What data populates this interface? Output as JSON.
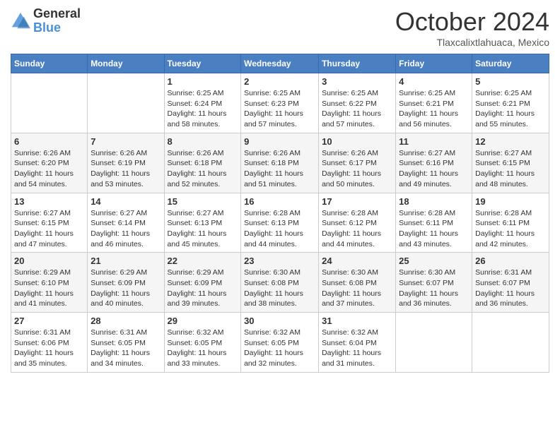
{
  "logo": {
    "general": "General",
    "blue": "Blue"
  },
  "header": {
    "month": "October 2024",
    "location": "Tlaxcalixtlahuaca, Mexico"
  },
  "days_of_week": [
    "Sunday",
    "Monday",
    "Tuesday",
    "Wednesday",
    "Thursday",
    "Friday",
    "Saturday"
  ],
  "weeks": [
    [
      {
        "day": "",
        "info": ""
      },
      {
        "day": "",
        "info": ""
      },
      {
        "day": "1",
        "info": "Sunrise: 6:25 AM\nSunset: 6:24 PM\nDaylight: 11 hours and 58 minutes."
      },
      {
        "day": "2",
        "info": "Sunrise: 6:25 AM\nSunset: 6:23 PM\nDaylight: 11 hours and 57 minutes."
      },
      {
        "day": "3",
        "info": "Sunrise: 6:25 AM\nSunset: 6:22 PM\nDaylight: 11 hours and 57 minutes."
      },
      {
        "day": "4",
        "info": "Sunrise: 6:25 AM\nSunset: 6:21 PM\nDaylight: 11 hours and 56 minutes."
      },
      {
        "day": "5",
        "info": "Sunrise: 6:25 AM\nSunset: 6:21 PM\nDaylight: 11 hours and 55 minutes."
      }
    ],
    [
      {
        "day": "6",
        "info": "Sunrise: 6:26 AM\nSunset: 6:20 PM\nDaylight: 11 hours and 54 minutes."
      },
      {
        "day": "7",
        "info": "Sunrise: 6:26 AM\nSunset: 6:19 PM\nDaylight: 11 hours and 53 minutes."
      },
      {
        "day": "8",
        "info": "Sunrise: 6:26 AM\nSunset: 6:18 PM\nDaylight: 11 hours and 52 minutes."
      },
      {
        "day": "9",
        "info": "Sunrise: 6:26 AM\nSunset: 6:18 PM\nDaylight: 11 hours and 51 minutes."
      },
      {
        "day": "10",
        "info": "Sunrise: 6:26 AM\nSunset: 6:17 PM\nDaylight: 11 hours and 50 minutes."
      },
      {
        "day": "11",
        "info": "Sunrise: 6:27 AM\nSunset: 6:16 PM\nDaylight: 11 hours and 49 minutes."
      },
      {
        "day": "12",
        "info": "Sunrise: 6:27 AM\nSunset: 6:15 PM\nDaylight: 11 hours and 48 minutes."
      }
    ],
    [
      {
        "day": "13",
        "info": "Sunrise: 6:27 AM\nSunset: 6:15 PM\nDaylight: 11 hours and 47 minutes."
      },
      {
        "day": "14",
        "info": "Sunrise: 6:27 AM\nSunset: 6:14 PM\nDaylight: 11 hours and 46 minutes."
      },
      {
        "day": "15",
        "info": "Sunrise: 6:27 AM\nSunset: 6:13 PM\nDaylight: 11 hours and 45 minutes."
      },
      {
        "day": "16",
        "info": "Sunrise: 6:28 AM\nSunset: 6:13 PM\nDaylight: 11 hours and 44 minutes."
      },
      {
        "day": "17",
        "info": "Sunrise: 6:28 AM\nSunset: 6:12 PM\nDaylight: 11 hours and 44 minutes."
      },
      {
        "day": "18",
        "info": "Sunrise: 6:28 AM\nSunset: 6:11 PM\nDaylight: 11 hours and 43 minutes."
      },
      {
        "day": "19",
        "info": "Sunrise: 6:28 AM\nSunset: 6:11 PM\nDaylight: 11 hours and 42 minutes."
      }
    ],
    [
      {
        "day": "20",
        "info": "Sunrise: 6:29 AM\nSunset: 6:10 PM\nDaylight: 11 hours and 41 minutes."
      },
      {
        "day": "21",
        "info": "Sunrise: 6:29 AM\nSunset: 6:09 PM\nDaylight: 11 hours and 40 minutes."
      },
      {
        "day": "22",
        "info": "Sunrise: 6:29 AM\nSunset: 6:09 PM\nDaylight: 11 hours and 39 minutes."
      },
      {
        "day": "23",
        "info": "Sunrise: 6:30 AM\nSunset: 6:08 PM\nDaylight: 11 hours and 38 minutes."
      },
      {
        "day": "24",
        "info": "Sunrise: 6:30 AM\nSunset: 6:08 PM\nDaylight: 11 hours and 37 minutes."
      },
      {
        "day": "25",
        "info": "Sunrise: 6:30 AM\nSunset: 6:07 PM\nDaylight: 11 hours and 36 minutes."
      },
      {
        "day": "26",
        "info": "Sunrise: 6:31 AM\nSunset: 6:07 PM\nDaylight: 11 hours and 36 minutes."
      }
    ],
    [
      {
        "day": "27",
        "info": "Sunrise: 6:31 AM\nSunset: 6:06 PM\nDaylight: 11 hours and 35 minutes."
      },
      {
        "day": "28",
        "info": "Sunrise: 6:31 AM\nSunset: 6:05 PM\nDaylight: 11 hours and 34 minutes."
      },
      {
        "day": "29",
        "info": "Sunrise: 6:32 AM\nSunset: 6:05 PM\nDaylight: 11 hours and 33 minutes."
      },
      {
        "day": "30",
        "info": "Sunrise: 6:32 AM\nSunset: 6:05 PM\nDaylight: 11 hours and 32 minutes."
      },
      {
        "day": "31",
        "info": "Sunrise: 6:32 AM\nSunset: 6:04 PM\nDaylight: 11 hours and 31 minutes."
      },
      {
        "day": "",
        "info": ""
      },
      {
        "day": "",
        "info": ""
      }
    ]
  ]
}
